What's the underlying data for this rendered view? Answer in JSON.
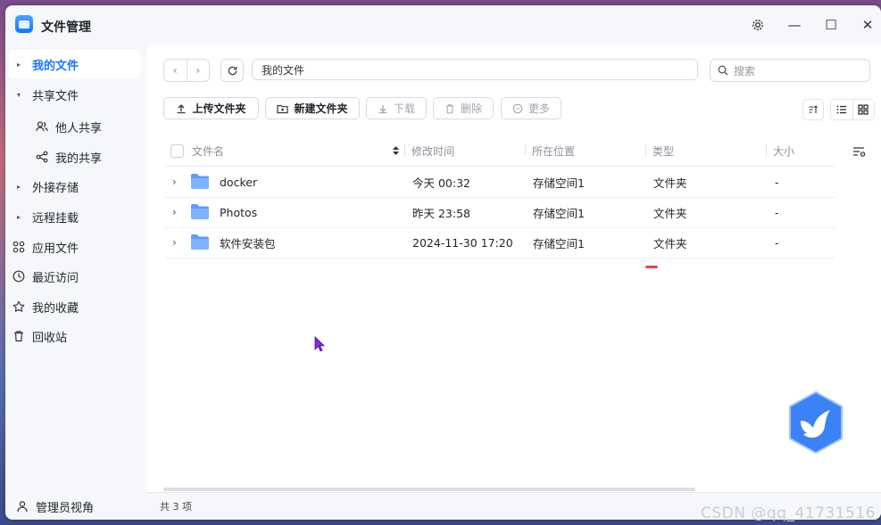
{
  "app": {
    "title": "文件管理"
  },
  "titlebar": {
    "settings_icon": "gear-icon",
    "minimize": "—",
    "maximize": "☐",
    "close": "✕"
  },
  "sidebar": {
    "items": [
      {
        "label": "我的文件",
        "icon": "caret-right",
        "active": true
      },
      {
        "label": "共享文件",
        "icon": "caret-down"
      },
      {
        "label": "他人共享",
        "icon": "users-icon"
      },
      {
        "label": "我的共享",
        "icon": "share-icon"
      },
      {
        "label": "外接存储",
        "icon": "caret-right"
      },
      {
        "label": "远程挂载",
        "icon": "caret-right"
      },
      {
        "label": "应用文件",
        "icon": "apps-icon"
      },
      {
        "label": "最近访问",
        "icon": "clock-icon"
      },
      {
        "label": "我的收藏",
        "icon": "star-icon"
      },
      {
        "label": "回收站",
        "icon": "trash-icon"
      }
    ],
    "footer": "管理员视角"
  },
  "path": {
    "current": "我的文件"
  },
  "search": {
    "placeholder": "搜索"
  },
  "toolbar": {
    "upload": "上传文件夹",
    "new_folder": "新建文件夹",
    "download": "下载",
    "delete": "删除",
    "more": "更多"
  },
  "table": {
    "headers": {
      "name": "文件名",
      "modified": "修改时间",
      "location": "所在位置",
      "type": "类型",
      "size": "大小"
    },
    "rows": [
      {
        "name": "docker",
        "modified": "今天 00:32",
        "location": "存储空间1",
        "type": "文件夹",
        "size": "-"
      },
      {
        "name": "Photos",
        "modified": "昨天 23:58",
        "location": "存储空间1",
        "type": "文件夹",
        "size": "-"
      },
      {
        "name": "软件安装包",
        "modified": "2024-11-30 17:20",
        "location": "存储空间1",
        "type": "文件夹",
        "size": "-"
      }
    ]
  },
  "status": {
    "count": "共 3 项"
  },
  "watermark": "CSDN @qq_41731516",
  "colors": {
    "accent": "#1677ff",
    "folder": "#5b9bff",
    "danger": "#e5484d"
  }
}
